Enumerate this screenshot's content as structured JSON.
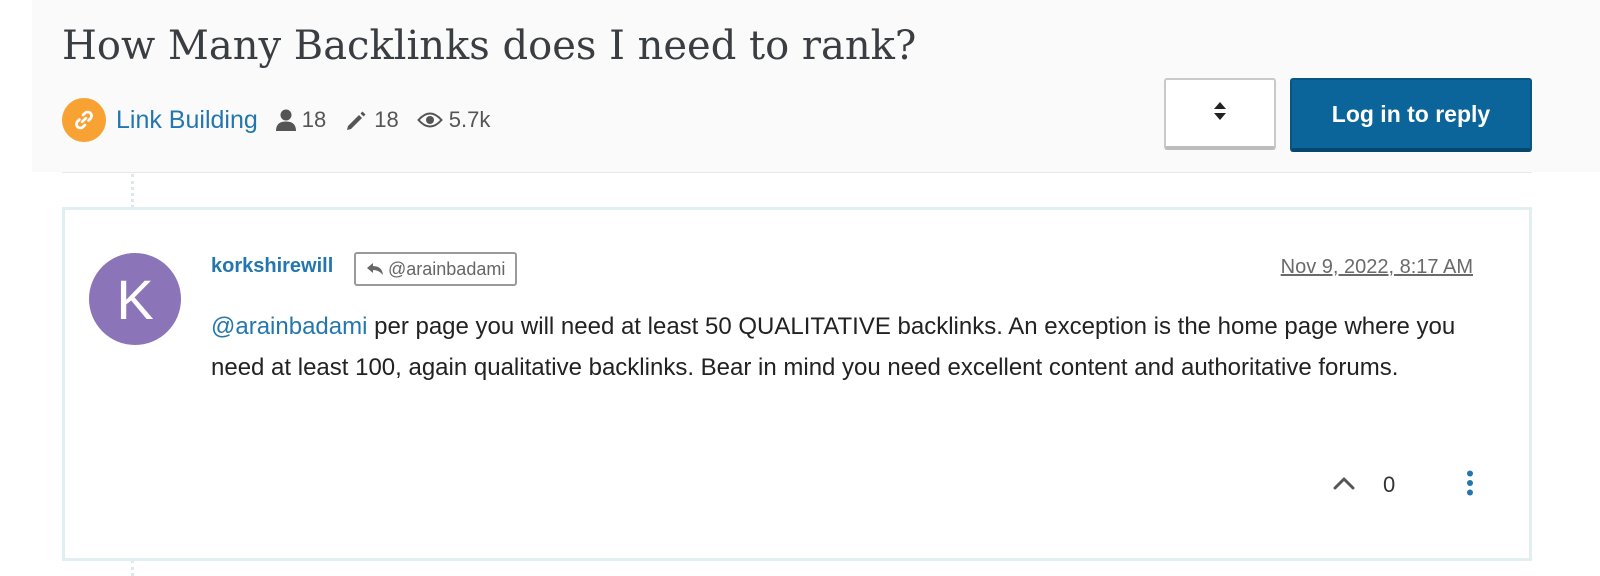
{
  "topic": {
    "title": "How Many Backlinks does I need to rank?",
    "category": {
      "label": "Link Building",
      "icon": "link-icon",
      "color": "#f7a233"
    },
    "stats": {
      "posters": "18",
      "posts": "18",
      "views": "5.7k"
    }
  },
  "actions": {
    "sort_icon": "sort-icon",
    "login_reply_label": "Log in to reply",
    "login_reply_color": "#0b659b"
  },
  "post": {
    "avatar_letter": "K",
    "avatar_color": "#8c74b8",
    "author": "korkshirewill",
    "in_reply_to": "@arainbadami",
    "timestamp": "Nov 9, 2022, 8:17 AM",
    "mention": "@arainbadami",
    "body_text": " per page you will need at least 50 QUALITATIVE backlinks. An exception is the home page where you need at least 100, again qualitative backlinks. Bear in mind you need excellent content and authoritative forums.",
    "votes": "0"
  }
}
